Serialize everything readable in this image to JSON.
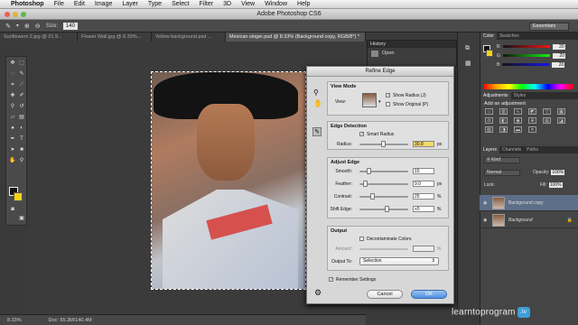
{
  "menubar": {
    "app": "Photoshop",
    "items": [
      "File",
      "Edit",
      "Image",
      "Layer",
      "Type",
      "Select",
      "Filter",
      "3D",
      "View",
      "Window",
      "Help"
    ]
  },
  "window": {
    "title": "Adobe Photoshop CS6"
  },
  "options": {
    "size_label": "Size:",
    "size_value": "140"
  },
  "workspace": {
    "label": "Essentials"
  },
  "tabs": [
    "Sunflowers 2.jpg @ 21.9...",
    "Flower Wall.jpg @ 8.33%...",
    "Yellow background.psd ...",
    "Mexican singer.psd @ 8.33% (Background copy, RGB/8*) *"
  ],
  "status": {
    "zoom": "8.33%",
    "doc": "Doc: 65.3M/140.4M"
  },
  "history": {
    "title": "History",
    "item": "Open"
  },
  "color_panel": {
    "tabs": [
      "Color",
      "Swatches"
    ],
    "rows": [
      [
        "R",
        "20"
      ],
      [
        "G",
        "20"
      ],
      [
        "B",
        "20"
      ]
    ]
  },
  "adjustments": {
    "tabs": [
      "Adjustments",
      "Styles"
    ],
    "heading": "Add an adjustment"
  },
  "layers": {
    "tabs": [
      "Layers",
      "Channels",
      "Paths"
    ],
    "kind": "Kind",
    "blend": "Normal",
    "opacity_label": "Opacity:",
    "opacity": "100%",
    "lock_label": "Lock:",
    "fill_label": "Fill:",
    "fill": "100%",
    "items": [
      {
        "name": "Background copy"
      },
      {
        "name": "Background"
      }
    ]
  },
  "refine_edge": {
    "title": "Refine Edge",
    "view_mode": {
      "title": "View Mode",
      "view_label": "View:",
      "show_radius": "Show Radius (J)",
      "show_original": "Show Original (P)"
    },
    "edge_detection": {
      "title": "Edge Detection",
      "smart_radius": "Smart Radius",
      "radius_label": "Radius:",
      "radius_value": "30.8",
      "radius_unit": "px"
    },
    "adjust_edge": {
      "title": "Adjust Edge",
      "rows": [
        {
          "label": "Smooth:",
          "value": "15",
          "unit": ""
        },
        {
          "label": "Feather:",
          "value": "9.0",
          "unit": "px"
        },
        {
          "label": "Contrast:",
          "value": "25",
          "unit": "%"
        },
        {
          "label": "Shift Edge:",
          "value": "+5",
          "unit": "%"
        }
      ]
    },
    "output": {
      "title": "Output",
      "decontaminate": "Decontaminate Colors",
      "amount_label": "Amount:",
      "output_to_label": "Output To:",
      "output_to_value": "Selection"
    },
    "remember": "Remember Settings",
    "cancel": "Cancel",
    "ok": "OK"
  },
  "watermark": {
    "text": "learntoprogram",
    "suffix": ".tv"
  }
}
